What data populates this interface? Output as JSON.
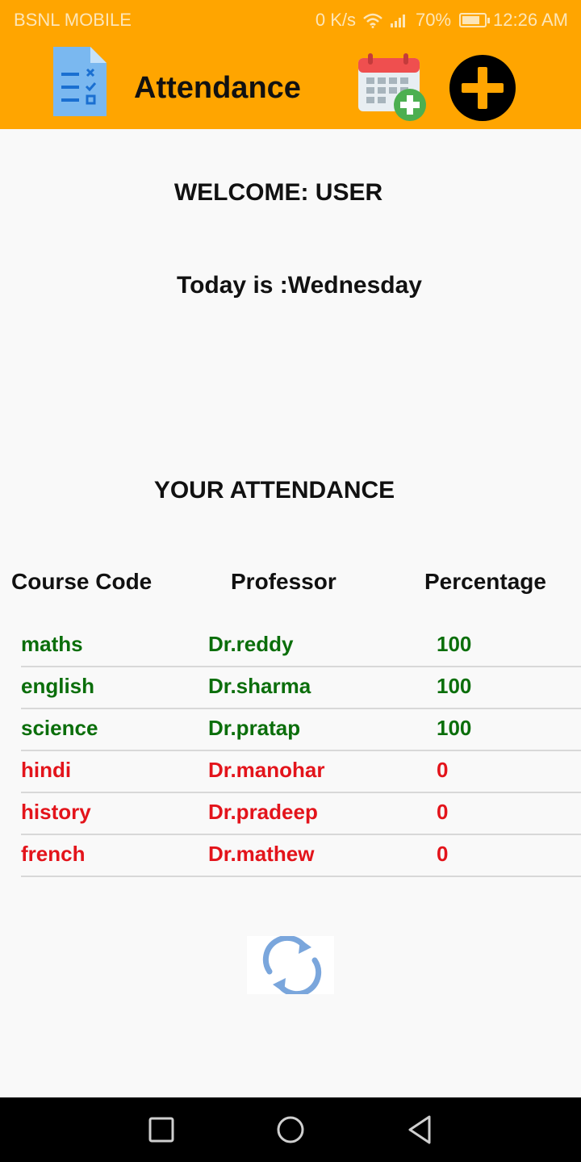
{
  "status_bar": {
    "carrier": "BSNL MOBILE",
    "speed": "0 K/s",
    "battery": "70%",
    "time": "12:26 AM",
    "icons": [
      "wifi-icon",
      "signal-icon",
      "battery-icon"
    ]
  },
  "toolbar": {
    "title": "Attendance",
    "background_color": "#ffa500",
    "icons": [
      "document-checklist-icon",
      "calendar-add-icon",
      "add-circle-icon"
    ]
  },
  "welcome_text": "WELCOME: USER",
  "today_text": "Today is :Wednesday",
  "section_title": "YOUR ATTENDANCE",
  "table": {
    "headers": [
      "Course Code",
      "Professor",
      "Percentage"
    ],
    "rows": [
      {
        "code": "maths",
        "professor": "Dr.reddy",
        "percentage": "100",
        "status_color": "#0b6e0b"
      },
      {
        "code": "english",
        "professor": "Dr.sharma",
        "percentage": "100",
        "status_color": "#0b6e0b"
      },
      {
        "code": "science",
        "professor": "Dr.pratap",
        "percentage": "100",
        "status_color": "#0b6e0b"
      },
      {
        "code": "hindi",
        "professor": "Dr.manohar",
        "percentage": "0",
        "status_color": "#e3141b"
      },
      {
        "code": "history",
        "professor": "Dr.pradeep",
        "percentage": "0",
        "status_color": "#e3141b"
      },
      {
        "code": "french",
        "professor": "Dr.mathew",
        "percentage": "0",
        "status_color": "#e3141b"
      }
    ]
  },
  "refresh_icon": "refresh-icon",
  "nav_bar": {
    "icons": [
      "recent-apps-icon",
      "home-icon",
      "back-icon"
    ]
  }
}
